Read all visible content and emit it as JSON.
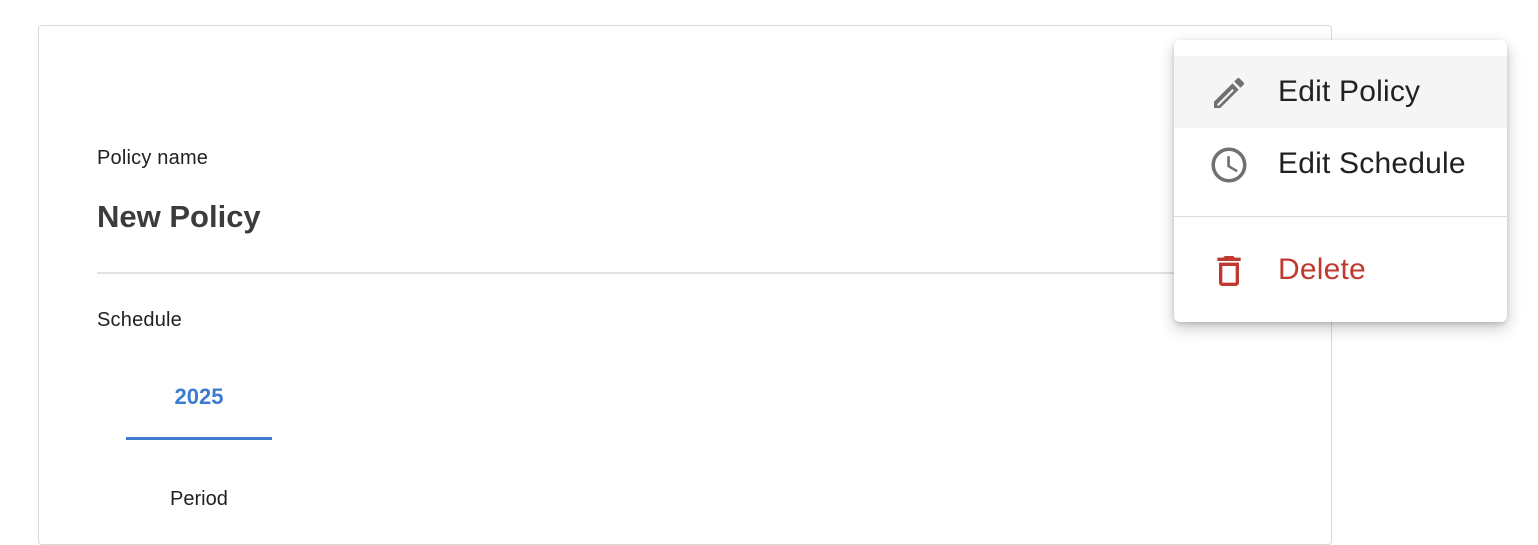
{
  "policy": {
    "name_label": "Policy name",
    "name_value": "New Policy",
    "schedule_label": "Schedule",
    "year_tab": "2025",
    "period_label": "Period"
  },
  "menu": {
    "items": [
      {
        "label": "Edit Policy",
        "icon": "pencil-icon"
      },
      {
        "label": "Edit Schedule",
        "icon": "clock-icon"
      },
      {
        "label": "Delete",
        "icon": "trash-icon",
        "color": "#c0392f"
      }
    ]
  },
  "colors": {
    "accent": "#3d7bd0",
    "danger": "#c0392f",
    "icon": "#707070"
  }
}
